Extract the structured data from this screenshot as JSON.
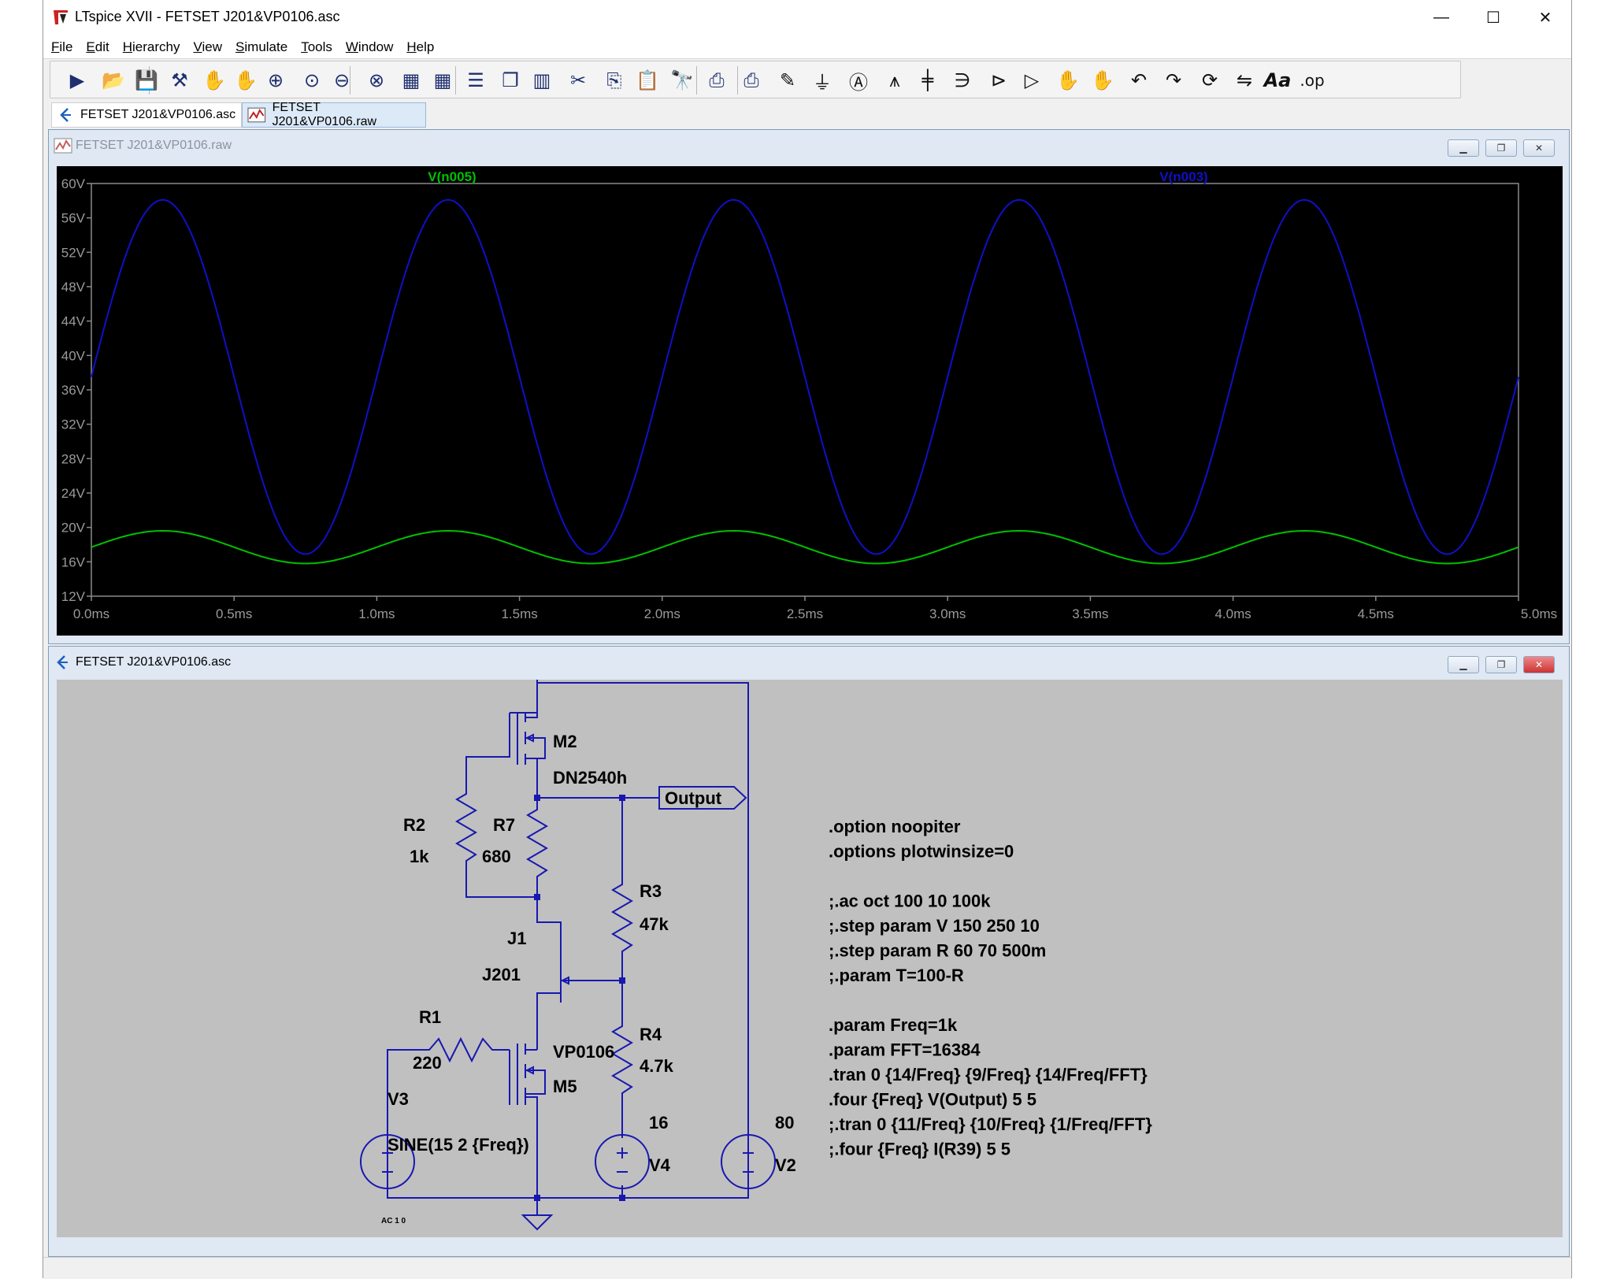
{
  "window": {
    "title": "LTspice XVII - FETSET J201&VP0106.asc",
    "minimize_glyph": "—",
    "maximize_glyph": "☐",
    "close_glyph": "✕"
  },
  "menu": [
    {
      "pre": "",
      "u": "F",
      "post": "ile"
    },
    {
      "pre": "",
      "u": "E",
      "post": "dit"
    },
    {
      "pre": "",
      "u": "H",
      "post": "ierarchy"
    },
    {
      "pre": "",
      "u": "V",
      "post": "iew"
    },
    {
      "pre": "",
      "u": "S",
      "post": "imulate"
    },
    {
      "pre": "",
      "u": "T",
      "post": "ools"
    },
    {
      "pre": "",
      "u": "W",
      "post": "indow"
    },
    {
      "pre": "",
      "u": "H",
      "post": "elp"
    }
  ],
  "toolbar": {
    "icons": [
      "run-icon",
      "open-icon",
      "save-icon",
      "control-panel-icon",
      "halt-icon",
      "pan-icon",
      "zoom-in-icon",
      "zoom-full-icon",
      "zoom-out-icon",
      "zoom-cancel-icon",
      "autorange-icon",
      "grid-icon",
      "tile-horizontal-icon",
      "cascade-icon",
      "tile-vertical-icon",
      "cut-icon",
      "copy-icon",
      "paste-icon",
      "find-icon",
      "print-icon",
      "print-preview-icon",
      "wire-icon",
      "ground-icon",
      "label-net-icon",
      "resistor-icon",
      "capacitor-icon",
      "inductor-icon",
      "diode-icon",
      "component-icon",
      "move-icon",
      "drag-icon",
      "undo-icon",
      "redo-icon",
      "rotate-icon",
      "mirror-icon",
      "text-icon",
      "spice-directive-icon"
    ],
    "text_label": "Aa",
    "op_label": ".op"
  },
  "tabs": [
    {
      "label": "FETSET J201&VP0106.asc",
      "icon": "schematic-icon"
    },
    {
      "label": "FETSET J201&VP0106.raw",
      "icon": "waveform-icon"
    }
  ],
  "plot_window": {
    "title": "FETSET J201&VP0106.raw",
    "traces": [
      {
        "name": "V(n005)",
        "color": "#00c000"
      },
      {
        "name": "V(n003)",
        "color": "#1010c8"
      }
    ]
  },
  "chart_data": {
    "type": "line",
    "title": "",
    "xlabel": "",
    "ylabel": "",
    "x_ticks": [
      "0.0ms",
      "0.5ms",
      "1.0ms",
      "1.5ms",
      "2.0ms",
      "2.5ms",
      "3.0ms",
      "3.5ms",
      "4.0ms",
      "4.5ms",
      "5.0ms"
    ],
    "y_ticks": [
      "60V",
      "56V",
      "52V",
      "48V",
      "44V",
      "40V",
      "36V",
      "32V",
      "28V",
      "24V",
      "20V",
      "16V",
      "12V"
    ],
    "xlim": [
      0,
      5.0
    ],
    "ylim": [
      12,
      60
    ],
    "grid": false,
    "background": "#000000",
    "series": [
      {
        "name": "V(n005)",
        "color": "#00c000",
        "offset": 17.7,
        "amplitude": 1.9,
        "period_ms": 1.0,
        "peak_at_ms": 0.25,
        "x": [
          0.0,
          0.25,
          0.5,
          0.75,
          1.0,
          1.25,
          1.5,
          1.75,
          2.0,
          2.25,
          2.5,
          2.75,
          3.0,
          3.25,
          3.5,
          3.75,
          4.0,
          4.25,
          4.5,
          4.75,
          5.0
        ],
        "y": [
          17.7,
          19.6,
          17.7,
          15.8,
          17.7,
          19.6,
          17.7,
          15.8,
          17.7,
          19.6,
          17.7,
          15.8,
          17.7,
          19.6,
          17.7,
          15.8,
          17.7,
          19.6,
          17.7,
          15.8,
          17.7
        ]
      },
      {
        "name": "V(n003)",
        "color": "#1010c8",
        "offset": 37.5,
        "amplitude": 20.6,
        "period_ms": 1.0,
        "peak_at_ms": 0.25,
        "x": [
          0.0,
          0.25,
          0.5,
          0.75,
          1.0,
          1.25,
          1.5,
          1.75,
          2.0,
          2.25,
          2.5,
          2.75,
          3.0,
          3.25,
          3.5,
          3.75,
          4.0,
          4.25,
          4.5,
          4.75,
          5.0
        ],
        "y": [
          37.5,
          58.1,
          37.5,
          16.9,
          37.5,
          58.1,
          37.5,
          16.9,
          37.5,
          58.1,
          37.5,
          16.9,
          37.5,
          58.1,
          37.5,
          16.9,
          37.5,
          58.1,
          37.5,
          16.9,
          37.5
        ]
      }
    ]
  },
  "schematic_window": {
    "title": "FETSET J201&VP0106.asc"
  },
  "schematic": {
    "wire_color": "#1818b0",
    "labels": {
      "m2": "M2",
      "m2_model": "DN2540h",
      "r2": "R2",
      "r2_val": "1k",
      "r7": "R7",
      "r7_val": "680",
      "r3": "R3",
      "r3_val": "47k",
      "r4": "R4",
      "r4_val": "4.7k",
      "j1": "J1",
      "j1_model": "J201",
      "r1": "R1",
      "r1_val": "220",
      "m5_model": "VP0106",
      "m5": "M5",
      "v3": "V3",
      "v3_val": "SINE(15 2 {Freq})",
      "v3_ac": "AC 1 0",
      "v4": "V4",
      "v4_val": "16",
      "v2": "V2",
      "v2_val": "80",
      "output": "Output"
    },
    "directives": [
      ".option noopiter",
      ".options plotwinsize=0",
      "",
      ";.ac oct 100 10 100k",
      ";.step param V 150 250 10",
      ";.step param R 60 70 500m",
      ";.param T=100-R",
      "",
      ".param Freq=1k",
      ".param FFT=16384",
      ".tran 0 {14/Freq} {9/Freq} {14/Freq/FFT}",
      ".four {Freq} V(Output) 5 5",
      ";.tran 0 {11/Freq} {10/Freq} {1/Freq/FFT}",
      ";.four {Freq} I(R39) 5 5"
    ]
  }
}
